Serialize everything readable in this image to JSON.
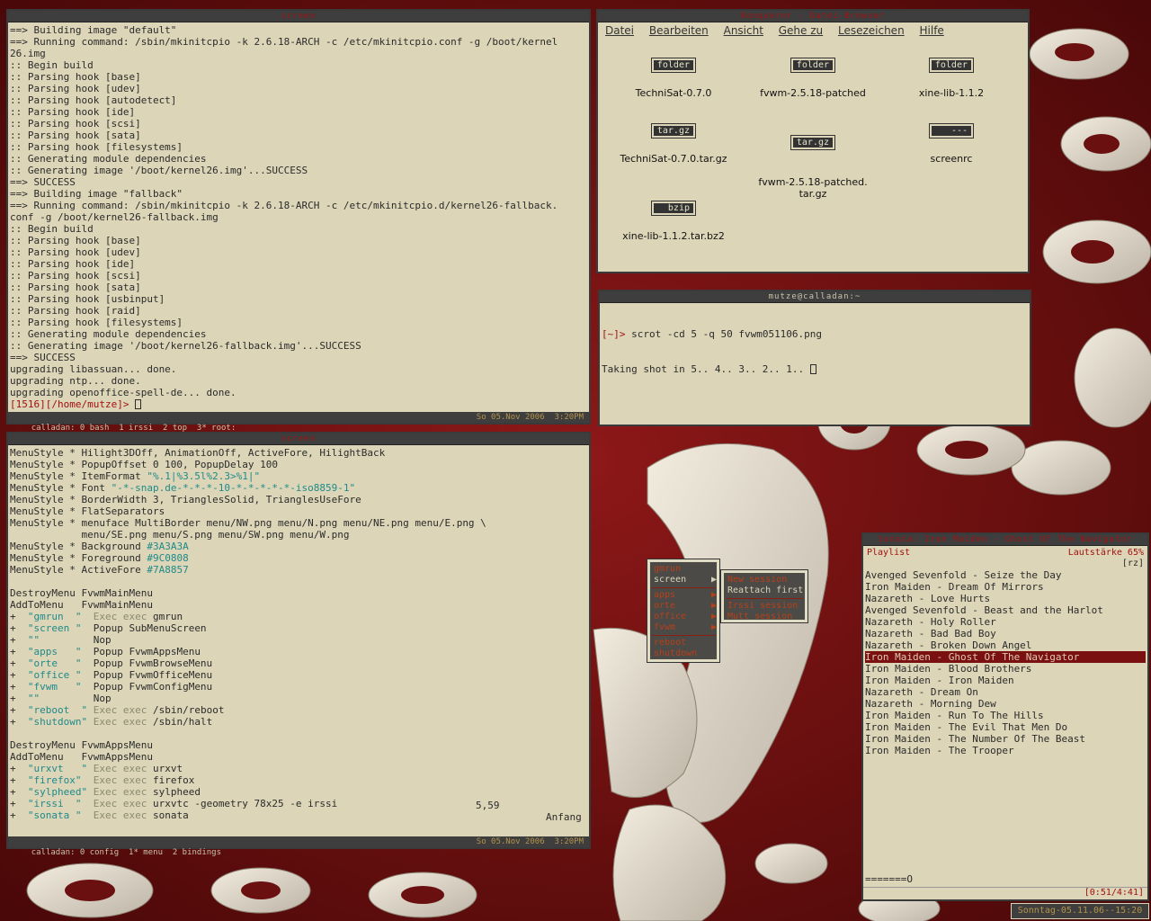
{
  "colors": {
    "desktop": "#7a1212",
    "window_bg": "#dcd5b7",
    "titlebar": "#3e3e3e",
    "accent": "#a31010",
    "teal": "#1f8a8a"
  },
  "screen_window": {
    "title": "screen",
    "lines": [
      "==> Building image \"default\"",
      "==> Running command: /sbin/mkinitcpio -k 2.6.18-ARCH -c /etc/mkinitcpio.conf -g /boot/kernel",
      "26.img",
      ":: Begin build",
      ":: Parsing hook [base]",
      ":: Parsing hook [udev]",
      ":: Parsing hook [autodetect]",
      ":: Parsing hook [ide]",
      ":: Parsing hook [scsi]",
      ":: Parsing hook [sata]",
      ":: Parsing hook [filesystems]",
      ":: Generating module dependencies",
      ":: Generating image '/boot/kernel26.img'...SUCCESS",
      "==> SUCCESS",
      "==> Building image \"fallback\"",
      "==> Running command: /sbin/mkinitcpio -k 2.6.18-ARCH -c /etc/mkinitcpio.d/kernel26-fallback.",
      "conf -g /boot/kernel26-fallback.img",
      ":: Begin build",
      ":: Parsing hook [base]",
      ":: Parsing hook [udev]",
      ":: Parsing hook [ide]",
      ":: Parsing hook [scsi]",
      ":: Parsing hook [sata]",
      ":: Parsing hook [usbinput]",
      ":: Parsing hook [raid]",
      ":: Parsing hook [filesystems]",
      ":: Generating module dependencies",
      ":: Generating image '/boot/kernel26-fallback.img'...SUCCESS",
      "==> SUCCESS",
      "upgrading libassuan... done.",
      "upgrading ntp... done.",
      "upgrading openoffice-spell-de... done."
    ],
    "prompt": "[1516][/home/mutze]>",
    "status_left": "calladan: 0 bash  1 irssi  2 top  3* root:",
    "status_right": "So 05.Nov 2006  3:20PM"
  },
  "vim_window": {
    "title": "screen",
    "lines": [
      [
        {
          "t": "MenuStyle * Hilight3DOff, AnimationOff, ActiveFore, HilightBack"
        }
      ],
      [
        {
          "t": "MenuStyle * PopupOffset 0 100, PopupDelay 100"
        }
      ],
      [
        {
          "t": "MenuStyle * ItemFormat "
        },
        {
          "t": "\"%.1|%3.5l%2.3>%1|\"",
          "c": "teal"
        }
      ],
      [
        {
          "t": "MenuStyle * Font "
        },
        {
          "t": "\"-*-snap.de-*-*-*-10-*-*-*-*-*-iso8859-1\"",
          "c": "teal"
        }
      ],
      [
        {
          "t": "MenuStyle * BorderWidth 3, TrianglesSolid, TrianglesUseFore"
        }
      ],
      [
        {
          "t": "MenuStyle * FlatSeparators"
        }
      ],
      [
        {
          "t": "MenuStyle * menuface MultiBorder menu/NW.png menu/N.png menu/NE.png menu/E.png \\"
        }
      ],
      [
        {
          "t": "            menu/SE.png menu/S.png menu/SW.png menu/W.png"
        }
      ],
      [
        {
          "t": "MenuStyle * Background "
        },
        {
          "t": "#3A3A3A",
          "c": "teal"
        }
      ],
      [
        {
          "t": "MenuStyle * Foreground "
        },
        {
          "t": "#9C0808",
          "c": "teal"
        }
      ],
      [
        {
          "t": "MenuStyle * ActiveFore "
        },
        {
          "t": "#7A8857",
          "c": "teal"
        }
      ],
      [
        {
          "t": ""
        }
      ],
      [
        {
          "t": "DestroyMenu FvwmMainMenu"
        }
      ],
      [
        {
          "t": "AddToMenu   FvwmMainMenu"
        }
      ],
      [
        {
          "t": "+  "
        },
        {
          "t": "\"gmrun  \"",
          "c": "teal"
        },
        {
          "t": "  Exec exec",
          "c": "gray"
        },
        {
          "t": " gmrun"
        }
      ],
      [
        {
          "t": "+  "
        },
        {
          "t": "\"screen \"",
          "c": "teal"
        },
        {
          "t": "  Popup SubMenuScreen"
        }
      ],
      [
        {
          "t": "+  "
        },
        {
          "t": "\"\"",
          "c": "teal"
        },
        {
          "t": "         Nop"
        }
      ],
      [
        {
          "t": "+  "
        },
        {
          "t": "\"apps   \"",
          "c": "teal"
        },
        {
          "t": "  Popup FvwmAppsMenu"
        }
      ],
      [
        {
          "t": "+  "
        },
        {
          "t": "\"orte   \"",
          "c": "teal"
        },
        {
          "t": "  Popup FvwmBrowseMenu"
        }
      ],
      [
        {
          "t": "+  "
        },
        {
          "t": "\"office \"",
          "c": "teal"
        },
        {
          "t": "  Popup FvwmOfficeMenu"
        }
      ],
      [
        {
          "t": "+  "
        },
        {
          "t": "\"fvwm   \"",
          "c": "teal"
        },
        {
          "t": "  Popup FvwmConfigMenu"
        }
      ],
      [
        {
          "t": "+  "
        },
        {
          "t": "\"\"",
          "c": "teal"
        },
        {
          "t": "         Nop"
        }
      ],
      [
        {
          "t": "+  "
        },
        {
          "t": "\"reboot  \"",
          "c": "teal"
        },
        {
          "t": " Exec exec",
          "c": "gray"
        },
        {
          "t": " /sbin/reboot"
        }
      ],
      [
        {
          "t": "+  "
        },
        {
          "t": "\"shutdown\"",
          "c": "teal"
        },
        {
          "t": " Exec exec",
          "c": "gray"
        },
        {
          "t": " /sbin/halt"
        }
      ],
      [
        {
          "t": ""
        }
      ],
      [
        {
          "t": "DestroyMenu FvwmAppsMenu"
        }
      ],
      [
        {
          "t": "AddToMenu   FvwmAppsMenu"
        }
      ],
      [
        {
          "t": "+  "
        },
        {
          "t": "\"urxvt   \"",
          "c": "teal"
        },
        {
          "t": " Exec exec",
          "c": "gray"
        },
        {
          "t": " urxvt"
        }
      ],
      [
        {
          "t": "+  "
        },
        {
          "t": "\"firefox\"",
          "c": "teal"
        },
        {
          "t": "  Exec exec",
          "c": "gray"
        },
        {
          "t": " firefox"
        }
      ],
      [
        {
          "t": "+  "
        },
        {
          "t": "\"sylpheed\"",
          "c": "teal"
        },
        {
          "t": " Exec exec",
          "c": "gray"
        },
        {
          "t": " sylpheed"
        }
      ],
      [
        {
          "t": "+  "
        },
        {
          "t": "\"irssi  \"",
          "c": "teal"
        },
        {
          "t": "  Exec exec",
          "c": "gray"
        },
        {
          "t": " urxvtc -geometry 78x25 -e irssi"
        }
      ],
      [
        {
          "t": "+  "
        },
        {
          "t": "\"sonata \"",
          "c": "teal"
        },
        {
          "t": "  Exec exec",
          "c": "gray"
        },
        {
          "t": " sonata"
        }
      ]
    ],
    "ruler_pos": "5,59",
    "ruler_where": "Anfang",
    "status_left": "calladan: 0 config  1* menu  2 bindings",
    "status_right": "So 05.Nov 2006  3:20PM"
  },
  "file_manager": {
    "title": "Konqueror - Datei-Browser",
    "menu": [
      "Datei",
      "Bearbeiten",
      "Ansicht",
      "Gehe zu",
      "Lesezeichen",
      "Hilfe"
    ],
    "items": [
      {
        "icon": "folder",
        "name": "TechniSat-0.7.0"
      },
      {
        "icon": "folder",
        "name": "fvwm-2.5.18-patched"
      },
      {
        "icon": "folder",
        "name": "xine-lib-1.1.2"
      },
      {
        "icon": "tar.gz",
        "name": "TechniSat-0.7.0.tar.gz"
      },
      {
        "icon": "tar.gz",
        "name": "fvwm-2.5.18-patched.\ntar.gz"
      },
      {
        "icon": "---",
        "name": "screenrc"
      },
      {
        "icon": "bzip",
        "name": "xine-lib-1.1.2.tar.bz2"
      }
    ]
  },
  "small_term": {
    "title": "mutze@calladan:~",
    "prompt": "[~]>",
    "command": " scrot -cd 5 -q 50 fvwm051106.png",
    "output": "Taking shot in 5.. 4.. 3.. 2.. 1.. "
  },
  "main_menu": {
    "items": [
      "gmrun",
      "screen",
      "apps",
      "orte",
      "office",
      "fvwm",
      "reboot",
      "shutdown"
    ],
    "active": "screen"
  },
  "sub_menu": {
    "items": [
      "New session",
      "Reattach first",
      "Irssi session",
      "Mutt session"
    ],
    "active": "Reattach first"
  },
  "playlist": {
    "title": "Sonata: Iron Maiden - Ghost Of The Navigator",
    "header": "Playlist",
    "volume": "Lautstärke 65%",
    "mode": "[rz]",
    "items": [
      "Avenged Sevenfold - Seize the Day",
      "Iron Maiden - Dream Of Mirrors",
      "Nazareth - Love Hurts",
      "Avenged Sevenfold - Beast and the Harlot",
      "Nazareth - Holy Roller",
      "Nazareth - Bad Bad Boy",
      "Nazareth - Broken Down Angel",
      "Iron Maiden - Ghost Of The Navigator",
      "Iron Maiden - Blood Brothers",
      "Iron Maiden - Iron Maiden",
      "Nazareth - Dream On",
      "Nazareth - Morning Dew",
      "Iron Maiden - Run To The Hills",
      "Iron Maiden - The Evil That Men Do",
      "Iron Maiden - The Number Of The Beast",
      "Iron Maiden - The Trooper"
    ],
    "current_index": 7,
    "progress_bar": "=======O",
    "time": "[0:51/4:41]"
  },
  "clock": "Sonntag-05.11.06--15:20"
}
